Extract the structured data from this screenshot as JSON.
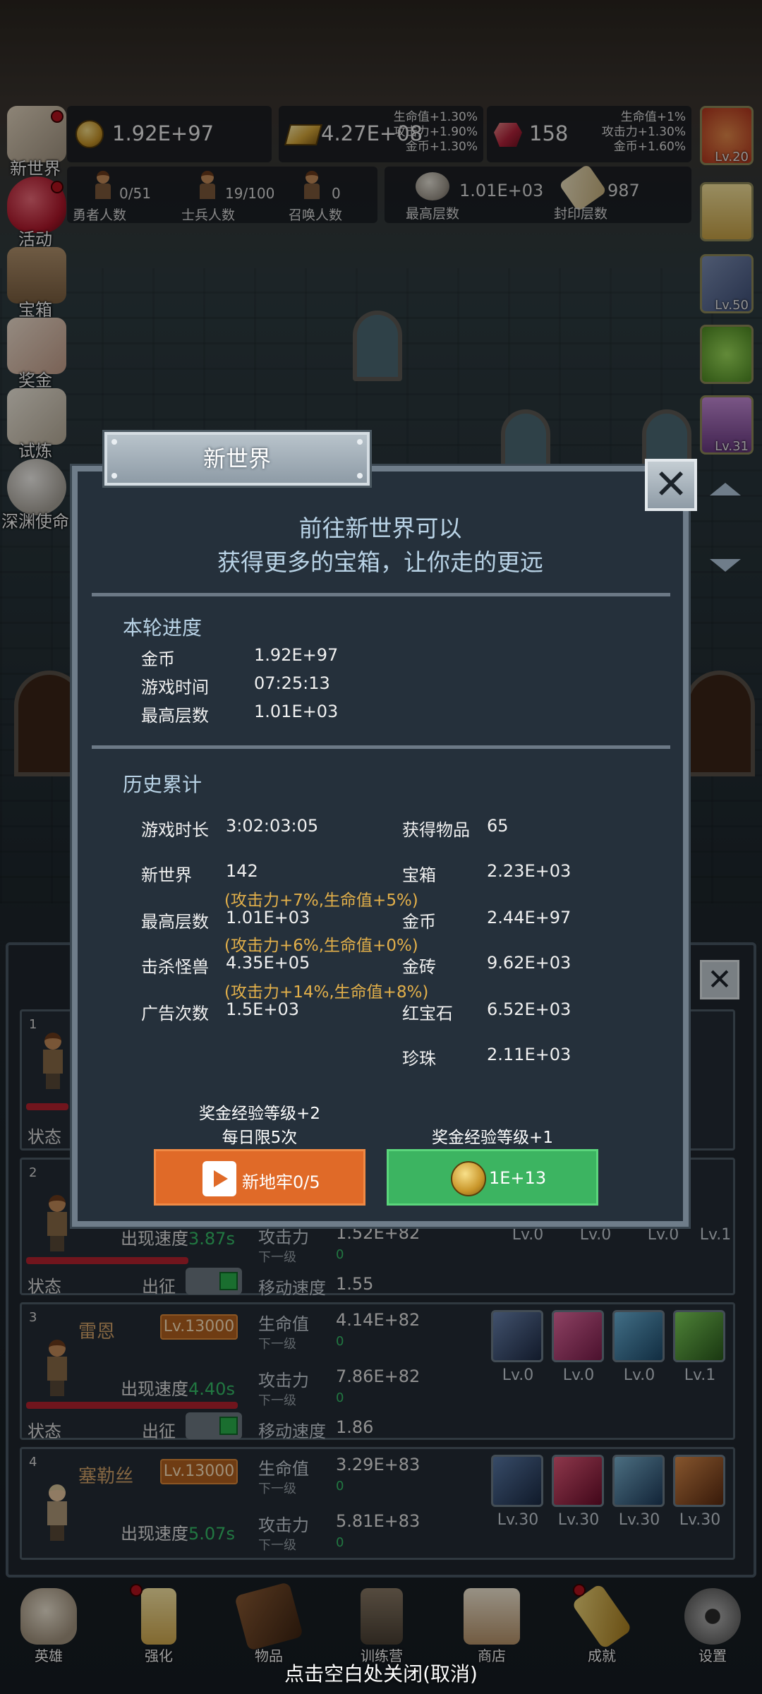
{
  "resources": {
    "gold": "1.92E+97",
    "gold_bar": "4.27E+08",
    "gold_bar_bonus": [
      "生命值+1.30%",
      "攻击力+1.90%",
      "金币+1.30%"
    ],
    "ruby": "158",
    "ruby_bonus": [
      "生命值+1%",
      "攻击力+1.30%",
      "金币+1.60%"
    ],
    "heroes_count": "0/51",
    "heroes_label": "勇者人数",
    "soldiers_count": "19/100",
    "soldiers_label": "士兵人数",
    "summons_count": "0",
    "summons_label": "召唤人数",
    "max_floor": "1.01E+03",
    "max_floor_label": "最高层数",
    "seal_floor": "987",
    "seal_floor_label": "封印层数"
  },
  "side_menu": [
    "新世界",
    "活动",
    "宝箱",
    "奖金",
    "试炼",
    "深渊使命"
  ],
  "right_items": [
    "Lv.20",
    "",
    "Lv.50",
    "",
    "Lv.31"
  ],
  "modal": {
    "title": "新世界",
    "close": "✕",
    "intro_line1": "前往新世界可以",
    "intro_line2": "获得更多的宝箱，让你走的更远",
    "current": {
      "title": "本轮进度",
      "rows": [
        {
          "label": "金币",
          "value": "1.92E+97"
        },
        {
          "label": "游戏时间",
          "value": "07:25:13"
        },
        {
          "label": "最高层数",
          "value": "1.01E+03"
        }
      ]
    },
    "history": {
      "title": "历史累计",
      "play_time_label": "游戏时长",
      "play_time": "3:02:03:05",
      "items_label": "获得物品",
      "items": "65",
      "left": [
        {
          "label": "新世界",
          "value": "142",
          "bonus": "(攻击力+7%,生命值+5%)"
        },
        {
          "label": "最高层数",
          "value": "1.01E+03",
          "bonus": "(攻击力+6%,生命值+0%)"
        },
        {
          "label": "击杀怪兽",
          "value": "4.35E+05",
          "bonus": "(攻击力+14%,生命值+8%)"
        },
        {
          "label": "广告次数",
          "value": "1.5E+03"
        }
      ],
      "right": [
        {
          "label": "宝箱",
          "value": "2.23E+03"
        },
        {
          "label": "金币",
          "value": "2.44E+97"
        },
        {
          "label": "金砖",
          "value": "9.62E+03"
        },
        {
          "label": "红宝石",
          "value": "6.52E+03"
        },
        {
          "label": "珍珠",
          "value": "2.11E+03"
        }
      ]
    },
    "note_left_1": "奖金经验等级+2",
    "note_left_2": "每日限5次",
    "note_right": "奖金经验等级+1",
    "btn_ad": "新地牢0/5",
    "btn_coin": "1E+13"
  },
  "heroes": [
    {
      "num": "1"
    },
    {
      "num": "2",
      "speed_label": "出现速度",
      "speed": "3.87s",
      "state": "状态",
      "go": "出征",
      "attack_label": "攻击力",
      "attack": "1.52E+82",
      "next": "下一级",
      "next_val": "0",
      "move_label": "移动速度",
      "move": "1.55",
      "skills": [
        "Lv.0",
        "Lv.0",
        "Lv.0",
        "Lv.1"
      ]
    },
    {
      "num": "3",
      "name": "雷恩",
      "level": "Lv.13000",
      "speed_label": "出现速度",
      "speed": "4.40s",
      "state": "状态",
      "go": "出征",
      "hp_label": "生命值",
      "hp": "4.14E+82",
      "next": "下一级",
      "next_val": "0",
      "attack_label": "攻击力",
      "attack": "7.86E+82",
      "move_label": "移动速度",
      "move": "1.86",
      "skills": [
        "Lv.0",
        "Lv.0",
        "Lv.0",
        "Lv.1"
      ]
    },
    {
      "num": "4",
      "name": "塞勒丝",
      "level": "Lv.13000",
      "speed_label": "出现速度",
      "speed": "5.07s",
      "hp_label": "生命值",
      "hp": "3.29E+83",
      "next": "下一级",
      "next_val": "0",
      "attack_label": "攻击力",
      "attack": "5.81E+83",
      "skills": [
        "Lv.30",
        "Lv.30",
        "Lv.30",
        "Lv.30"
      ]
    }
  ],
  "hero1_state": "状态",
  "nav": [
    "英雄",
    "强化",
    "物品",
    "训练营",
    "商店",
    "成就",
    "设置"
  ],
  "footer_hint": "点击空白处关闭(取消)",
  "colors": {
    "accent_orange": "#e06a28",
    "accent_green": "#3cb461",
    "bonus_gold": "#e3b04a"
  }
}
